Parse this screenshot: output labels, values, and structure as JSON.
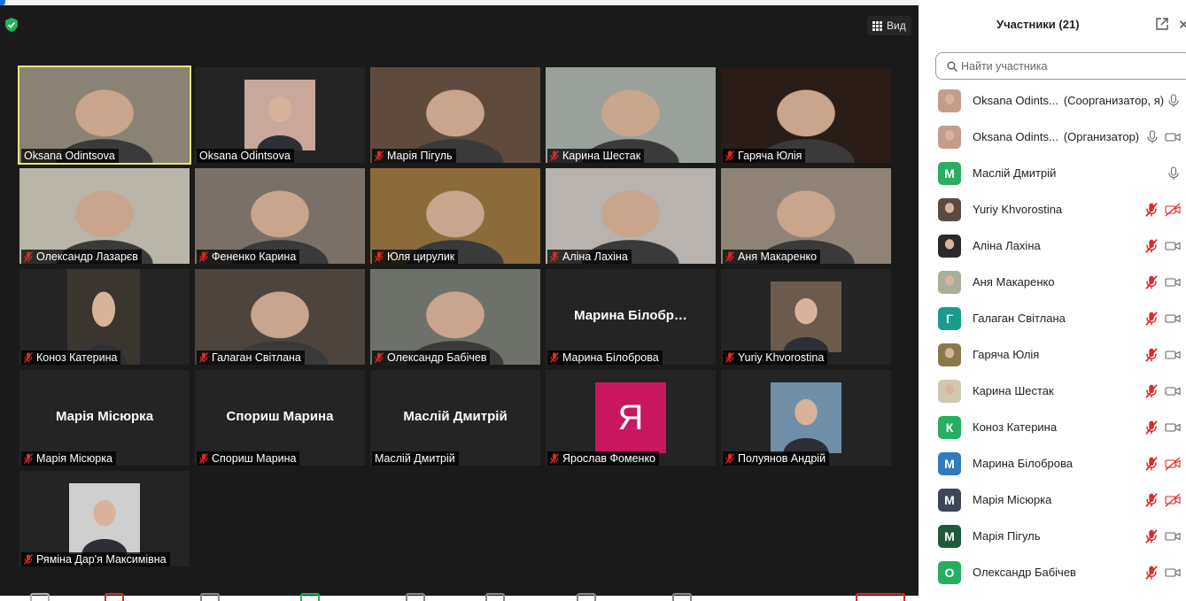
{
  "meeting": {
    "view_label": "Вид"
  },
  "tiles": [
    {
      "name": "Oksana Odintsova",
      "type": "video",
      "muted": false,
      "active": true,
      "bg": "#8a8275"
    },
    {
      "name": "Oksana Odintsova",
      "type": "photo",
      "muted": false,
      "bg": "#242424",
      "photo": "#c9a79a"
    },
    {
      "name": "Марія Пігуль",
      "type": "video",
      "muted": true,
      "bg": "#5e4b3e"
    },
    {
      "name": "Карина Шестак",
      "type": "video",
      "muted": true,
      "bg": "#9aa09a"
    },
    {
      "name": "Гаряча Юлія",
      "type": "video",
      "muted": true,
      "bg": "#2a1c16"
    },
    {
      "name": "Олександр Лазарєв",
      "type": "video",
      "muted": true,
      "bg": "#b9b5a8"
    },
    {
      "name": "Фененко Карина",
      "type": "video",
      "muted": true,
      "bg": "#7a7068"
    },
    {
      "name": "Юля цирулик",
      "type": "video",
      "muted": true,
      "bg": "#8c6a3a"
    },
    {
      "name": "Аліна Лахіна",
      "type": "video",
      "muted": true,
      "bg": "#b8b3ae"
    },
    {
      "name": "Аня Макаренко",
      "type": "video",
      "muted": true,
      "bg": "#8f8378"
    },
    {
      "name": "Коноз Катерина",
      "type": "photo-wide",
      "muted": true,
      "bg": "#242424",
      "photo": "#3b3530"
    },
    {
      "name": "Галаган Світлана",
      "type": "video",
      "muted": true,
      "bg": "#4d443d"
    },
    {
      "name": "Олександр Бабічев",
      "type": "video",
      "muted": true,
      "bg": "#6e7169"
    },
    {
      "name": "Марина Білоброва",
      "type": "name",
      "muted": true,
      "center": "Марина  Білобр…"
    },
    {
      "name": "Yuriy Khvorostina",
      "type": "photo",
      "muted": true,
      "bg": "#242424",
      "photo": "#6a5b4e"
    },
    {
      "name": "Марія Місюрка",
      "type": "name",
      "muted": true,
      "center": "Марія Місюрка"
    },
    {
      "name": "Спориш Марина",
      "type": "name",
      "muted": true,
      "center": "Спориш Марина"
    },
    {
      "name": "Маслій Дмитрій",
      "type": "name",
      "muted": false,
      "center": "Маслій Дмитрій"
    },
    {
      "name": "Ярослав Фоменко",
      "type": "letter",
      "muted": true,
      "letter": "Я"
    },
    {
      "name": "Полуянов Андрій",
      "type": "photo",
      "muted": true,
      "bg": "#242424",
      "photo": "#6f8ea8"
    },
    {
      "name": "Ряміна Дар'я Максимівна",
      "type": "photo",
      "muted": true,
      "bg": "#242424",
      "photo": "#cfcfcf"
    }
  ],
  "panel": {
    "title": "Участники (21)",
    "search_placeholder": "Найти участника",
    "participants": [
      {
        "name": "Oksana Odints...",
        "role": "(Соорганизатор, я)",
        "avatar": "photo",
        "color": "#c79b8a",
        "mic": "on",
        "cam": "none"
      },
      {
        "name": "Oksana Odints...",
        "role": "(Организатор)",
        "avatar": "photo",
        "color": "#c79b8a",
        "mic": "on",
        "cam": "on"
      },
      {
        "name": "Маслій Дмитрій",
        "role": "",
        "avatar": "letter",
        "letter": "M",
        "color": "#27ae60",
        "mic": "on",
        "cam": "none"
      },
      {
        "name": "Yuriy Khvorostina",
        "role": "",
        "avatar": "photo",
        "color": "#5a4a40",
        "mic": "off",
        "cam": "off"
      },
      {
        "name": "Аліна Лахіна",
        "role": "",
        "avatar": "photo",
        "color": "#2a2a2a",
        "mic": "off",
        "cam": "on"
      },
      {
        "name": "Аня Макаренко",
        "role": "",
        "avatar": "photo",
        "color": "#a8b09a",
        "mic": "off",
        "cam": "on"
      },
      {
        "name": "Галаган Світлана",
        "role": "",
        "avatar": "letter",
        "letter": "Г",
        "color": "#1a9c8c",
        "mic": "off",
        "cam": "on"
      },
      {
        "name": "Гаряча Юлія",
        "role": "",
        "avatar": "photo",
        "color": "#8a7a4a",
        "mic": "off",
        "cam": "on"
      },
      {
        "name": "Карина Шестак",
        "role": "",
        "avatar": "photo",
        "color": "#cfc8b0",
        "mic": "off",
        "cam": "on"
      },
      {
        "name": "Коноз Катерина",
        "role": "",
        "avatar": "letter",
        "letter": "К",
        "color": "#27ae60",
        "mic": "off",
        "cam": "on"
      },
      {
        "name": "Марина Білоброва",
        "role": "",
        "avatar": "letter",
        "letter": "М",
        "color": "#2e7bbf",
        "mic": "off",
        "cam": "off"
      },
      {
        "name": "Марія Місюрка",
        "role": "",
        "avatar": "letter",
        "letter": "М",
        "color": "#3c4656",
        "mic": "off",
        "cam": "off"
      },
      {
        "name": "Марія Пігуль",
        "role": "",
        "avatar": "letter",
        "letter": "M",
        "color": "#1e5a3c",
        "mic": "off",
        "cam": "on"
      },
      {
        "name": "Олександр Бабічев",
        "role": "",
        "avatar": "letter",
        "letter": "О",
        "color": "#27ae60",
        "mic": "off",
        "cam": "on"
      }
    ]
  }
}
